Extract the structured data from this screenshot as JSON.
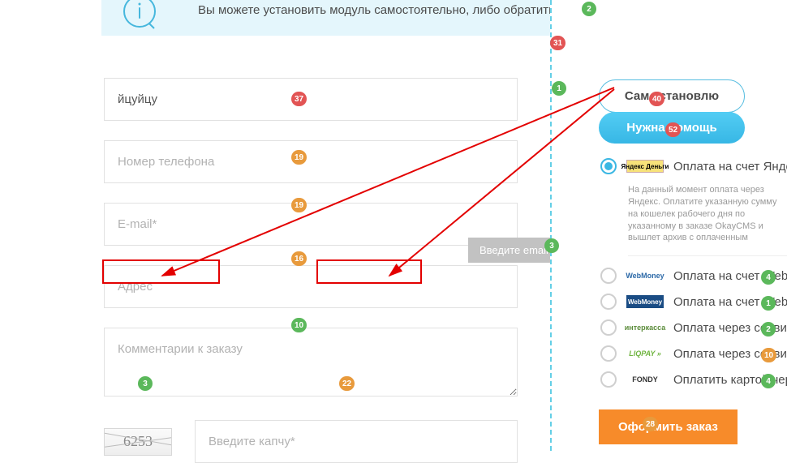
{
  "banner": {
    "text": "Вы можете установить модуль самостоятельно, либо обратиться за помощью к разработчику"
  },
  "form": {
    "name_value": "йцуйцу",
    "phone_placeholder": "Номер телефона",
    "email_placeholder": "E-mail*",
    "address_placeholder": "Адрес",
    "comment_placeholder": "Комментарии к заказу",
    "captcha_code": "6253",
    "captcha_placeholder": "Введите капчу*"
  },
  "tooltip": {
    "text": "Введите email"
  },
  "pills": {
    "self": "Сам установлю",
    "help": "Нужна помощь"
  },
  "payments": [
    {
      "label": "Оплата на счет Яндекс",
      "logo": "Яндекс Деньги",
      "selected": true
    },
    {
      "label": "Оплата на счет WebMoney",
      "logo": "WebMoney",
      "selected": false
    },
    {
      "label": "Оплата на счет WebMoney",
      "logo": "WebMoney",
      "selected": false
    },
    {
      "label": "Оплата через сервис",
      "logo": "интеркасса",
      "selected": false
    },
    {
      "label": "Оплата через сервис",
      "logo": "LIQPAY »",
      "selected": false
    },
    {
      "label": "Оплатить картой через",
      "logo": "FONDY",
      "selected": false
    }
  ],
  "payment_desc": "На данный момент оплата через Яндекс. Оплатите указанную сумму на кошелек рабочего дня по указанному в заказе OkayCMS и вышлет архив с оплаченным",
  "order_btn": "Оформить заказ",
  "bubbles": {
    "b2": "2",
    "b31": "31",
    "b1": "1",
    "b40": "40",
    "b52": "52",
    "b37": "37",
    "b19a": "19",
    "b19b": "19",
    "b16": "16",
    "b10": "10",
    "b3a": "3",
    "b3b": "3",
    "b22": "22",
    "p4a": "4",
    "p1": "1",
    "p2": "2",
    "p10": "10",
    "p4b": "4",
    "b28": "28"
  }
}
